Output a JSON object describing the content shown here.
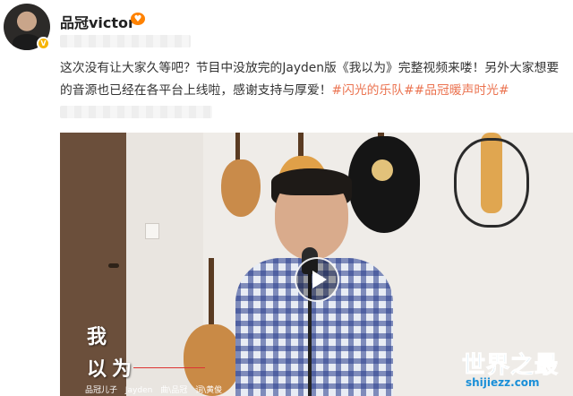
{
  "post": {
    "author": "品冠victor",
    "verified_badge": "V",
    "emoji_icon": "heart-icon",
    "text": "这次没有让大家久等吧？节目中没放完的Jayden版《我以为》完整视频来喽！另外大家想要的音源也已经在各平台上线啦，感谢支持与厚爱！",
    "topics": [
      "#闪光的乐队#",
      "#品冠暖声时光#"
    ]
  },
  "video": {
    "title_line1": "我",
    "title_line2": "以为",
    "credit": "品冠儿子 Jayden  曲\\品冠  词\\黄俊"
  },
  "watermark": {
    "name": "世界之最",
    "url": "shijiezz.com"
  },
  "colors": {
    "topic": "#eb7350",
    "watermark": "#1a8fd8",
    "badge": "#f7b500"
  }
}
